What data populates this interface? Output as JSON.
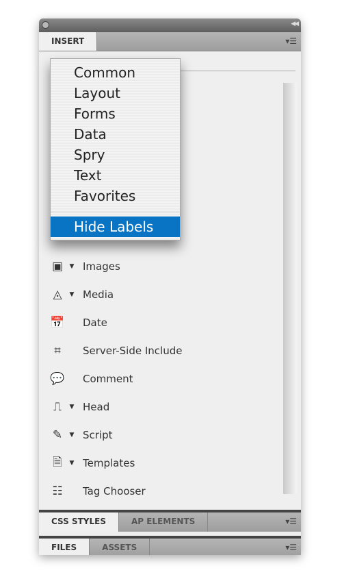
{
  "panel": {
    "insert_tab": "INSERT"
  },
  "menu": {
    "items": [
      "Common",
      "Layout",
      "Forms",
      "Data",
      "Spry",
      "Text",
      "Favorites"
    ],
    "selected": "Hide Labels"
  },
  "items": [
    {
      "label": "Images",
      "icon": "image-icon",
      "glyph": "▣",
      "dropdown": true
    },
    {
      "label": "Media",
      "icon": "media-icon",
      "glyph": "◬",
      "dropdown": true
    },
    {
      "label": "Date",
      "icon": "calendar-icon",
      "glyph": "📅",
      "dropdown": false
    },
    {
      "label": "Server-Side Include",
      "icon": "ssi-icon",
      "glyph": "⌗",
      "dropdown": false
    },
    {
      "label": "Comment",
      "icon": "comment-icon",
      "glyph": "💬",
      "dropdown": false
    },
    {
      "label": "Head",
      "icon": "head-icon",
      "glyph": "⎍",
      "dropdown": true
    },
    {
      "label": "Script",
      "icon": "script-icon",
      "glyph": "✎",
      "dropdown": true
    },
    {
      "label": "Templates",
      "icon": "templates-icon",
      "glyph": "🗎",
      "dropdown": true
    },
    {
      "label": "Tag Chooser",
      "icon": "tag-chooser-icon",
      "glyph": "☷",
      "dropdown": false
    }
  ],
  "css_bar": {
    "tabs": [
      "CSS STYLES",
      "AP ELEMENTS"
    ]
  },
  "files_bar": {
    "tabs": [
      "FILES",
      "ASSETS"
    ]
  },
  "colors": {
    "selection": "#0a74c4"
  }
}
